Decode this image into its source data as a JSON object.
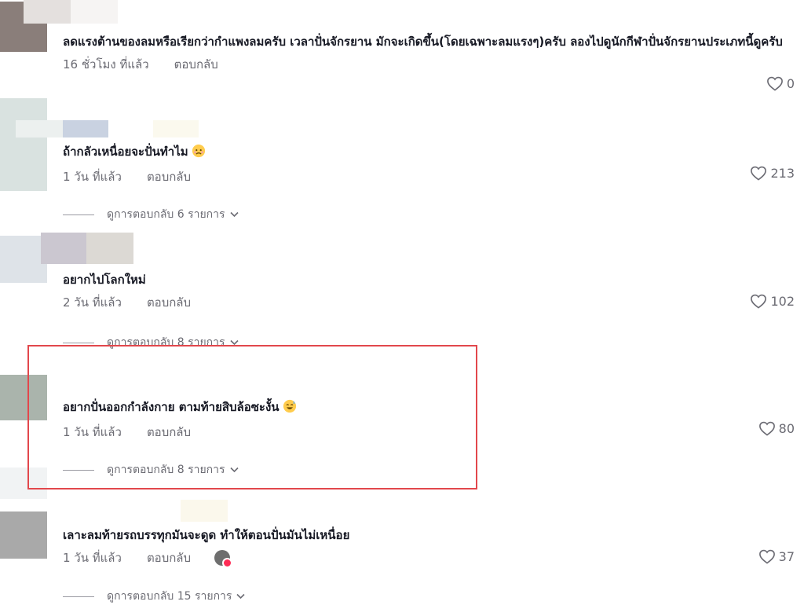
{
  "comments": [
    {
      "text": "ลดแรงต้านของลมหรือเรียกว่ากำแพงลมครับ เวลาปั่นจักรยาน มักจะเกิดขึ้น(โดยเฉพาะลมแรงๆ)ครับ ลองไปดูนักกีฬาปั่นจักรยานประเภทนี้ดูครับ",
      "time": "16 ชั่วโมง ที่แล้ว",
      "reply": "ตอบกลับ",
      "likes": "0"
    },
    {
      "text": "ถ้ากลัวเหนื่อยจะปั่นทำไม",
      "emoji": "sad-face-emoji",
      "time": "1 วัน ที่แล้ว",
      "reply": "ตอบกลับ",
      "likes": "213",
      "view_replies": "ดูการตอบกลับ 6 รายการ"
    },
    {
      "text": "อยากไปโลกใหม่",
      "time": "2 วัน ที่แล้ว",
      "reply": "ตอบกลับ",
      "likes": "102",
      "view_replies": "ดูการตอบกลับ 8 รายการ"
    },
    {
      "text": "อยากปั่นออกกำลังกาย ตามท้ายสิบล้อซะงั้น",
      "emoji": "sweat-smile-emoji",
      "time": "1 วัน ที่แล้ว",
      "reply": "ตอบกลับ",
      "likes": "80",
      "view_replies": "ดูการตอบกลับ 8 รายการ"
    },
    {
      "text": "เลาะลมท้ายรถบรรทุกมันจะดูด ทำให้ตอนปั่นมันไม่เหนื่อย",
      "time": "1 วัน ที่แล้ว",
      "reply": "ตอบกลับ",
      "likes": "37",
      "view_replies": "ดูการตอบกลับ 15 รายการ"
    }
  ],
  "colors": {
    "highlight": "#e2474c",
    "text_primary": "#161823",
    "text_secondary": "#6b6b73"
  }
}
